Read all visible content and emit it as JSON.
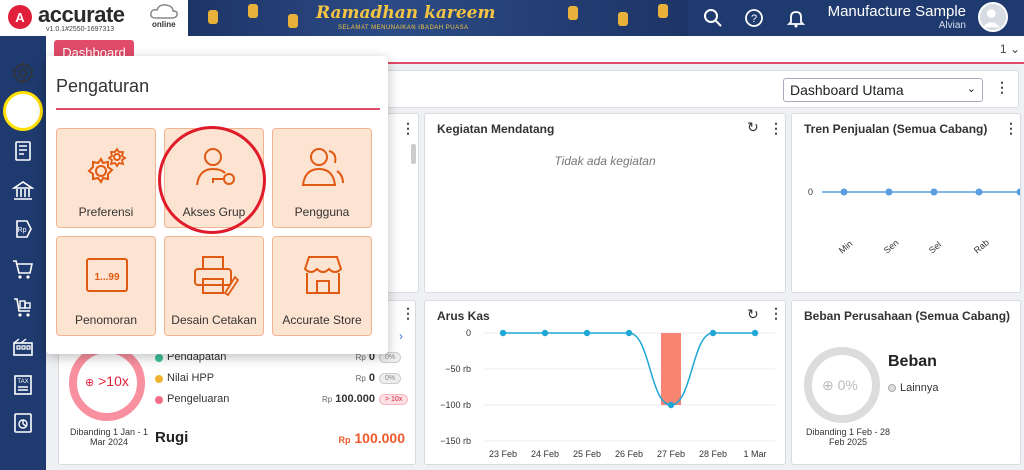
{
  "header": {
    "logo_text": "accurate",
    "logo_online": "online",
    "version": "v1.0.1#2550-1697313",
    "banner_title": "Ramadhan kareem",
    "banner_sub": "SELAMAT MENUNAIKAN IBADAH PUASA",
    "company": "Manufacture Sample",
    "user": "Alvian",
    "icons": [
      "search-icon",
      "help-icon",
      "bell-icon",
      "avatar"
    ]
  },
  "tabs": {
    "active": "Dashboard",
    "count": "1"
  },
  "sidebar": {
    "items": [
      "gear-icon",
      "building-icon",
      "book-icon",
      "bank-icon",
      "price-tag-icon",
      "cart-icon",
      "warehouse-cart-icon",
      "factory-icon",
      "tax-icon",
      "report-icon"
    ]
  },
  "dashboard": {
    "selector": "Dashboard Utama"
  },
  "popup": {
    "title": "Pengaturan",
    "tiles": [
      {
        "label": "Preferensi",
        "icon": "gears-icon"
      },
      {
        "label": "Akses Grup",
        "icon": "user-key-icon"
      },
      {
        "label": "Pengguna",
        "icon": "users-icon"
      },
      {
        "label": "Penomoran",
        "icon": "numbering-icon"
      },
      {
        "label": "Desain Cetakan",
        "icon": "printer-icon"
      },
      {
        "label": "Accurate Store",
        "icon": "store-icon"
      }
    ]
  },
  "kegiatan": {
    "title": "Kegiatan Mendatang",
    "empty": "Tidak ada kegiatan"
  },
  "tren": {
    "title": "Tren Penjualan (Semua Cabang)"
  },
  "aruskas": {
    "title": "Arus Kas"
  },
  "beban": {
    "title": "Beban Perusahaan (Semua Cabang)",
    "donut_label": "0%",
    "heading": "Beban",
    "legend": "Lainnya",
    "compare": "Dibanding 1 Feb - 28 Feb 2025"
  },
  "labarugi": {
    "ratio": ">10x",
    "compare": "Dibanding 1 Jan - 1 Mar 2024",
    "rows": [
      {
        "label": "Pendapatan",
        "currency": "Rp",
        "value": "0",
        "pill": "0%",
        "color": "#3bbf9a"
      },
      {
        "label": "Nilai HPP",
        "currency": "Rp",
        "value": "0",
        "pill": "0%",
        "color": "#f0b232"
      },
      {
        "label": "Pengeluaran",
        "currency": "Rp",
        "value": "100.000",
        "pill": "> 10x",
        "color": "#f06d8c"
      }
    ],
    "result_label": "Rugi",
    "result_currency": "Rp",
    "result_value": "100.000"
  },
  "chart_data": [
    {
      "type": "line",
      "title": "Tren Penjualan (Semua Cabang)",
      "categories": [
        "Min",
        "Sen",
        "Sel",
        "Rab"
      ],
      "ytick": "0",
      "series": [
        {
          "values": [
            0,
            0,
            0,
            0,
            0
          ]
        }
      ]
    },
    {
      "type": "line",
      "title": "Arus Kas",
      "categories": [
        "23 Feb",
        "24 Feb",
        "25 Feb",
        "26 Feb",
        "27 Feb",
        "28 Feb",
        "1 Mar"
      ],
      "yticks": [
        "0",
        "−50 rb",
        "−100 rb",
        "−150 rb"
      ],
      "ylim": [
        -150000,
        0
      ],
      "series": [
        {
          "type": "line",
          "values": [
            0,
            0,
            0,
            0,
            -100000,
            0,
            0
          ]
        },
        {
          "type": "bar",
          "values": [
            0,
            0,
            0,
            0,
            -100000,
            0,
            0
          ]
        }
      ]
    }
  ]
}
